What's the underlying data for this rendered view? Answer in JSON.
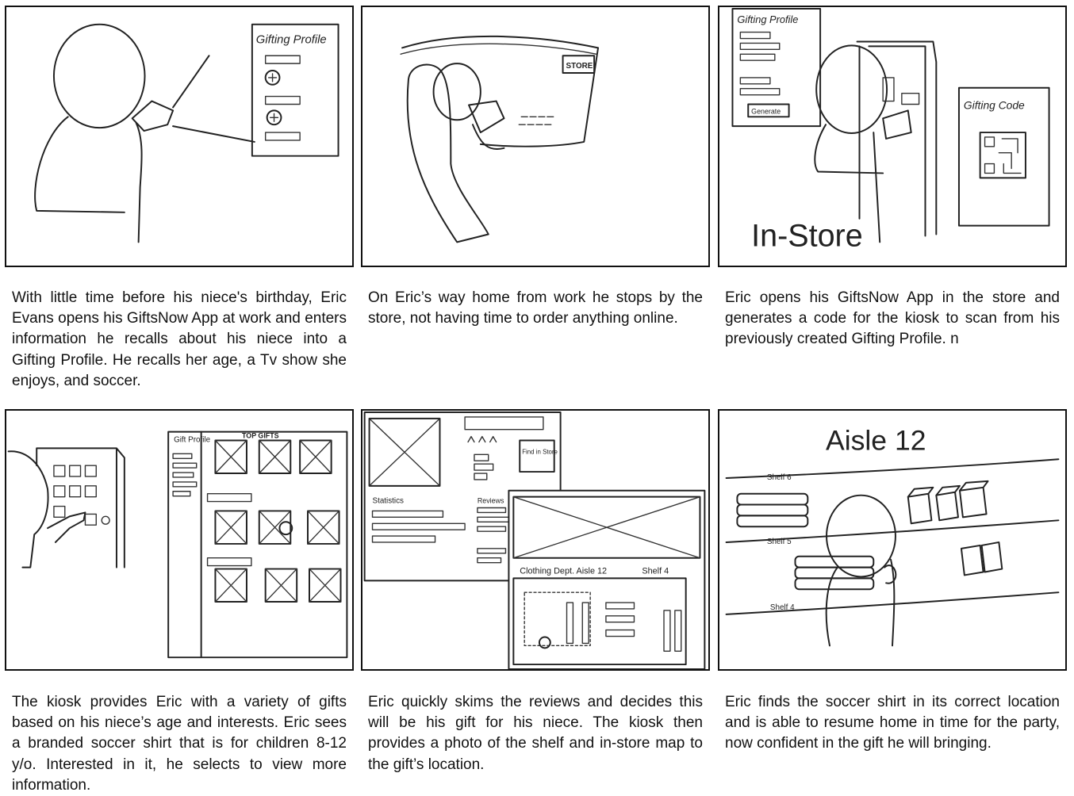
{
  "panels": [
    {
      "caption": "With little time before his niece's birthday, Eric Evans opens his GiftsNow App at work and enters information he recalls about his niece into a Gifting Profile. He recalls her age, a Tv show she enjoys, and soccer.",
      "labels": [
        "Gifting Profile"
      ]
    },
    {
      "caption": "On Eric’s way home from work he stops by the store, not having time to order anything online.",
      "labels": [
        "STORE"
      ]
    },
    {
      "caption": "Eric opens his GiftsNow App in the store and generates a code for the kiosk to scan from his previously created Gifting Profile. n",
      "labels": [
        "Gifting Profile",
        "Generate",
        "Gifting Code",
        "In-Store"
      ]
    },
    {
      "caption": "The kiosk provides Eric with a variety of gifts based on his niece’s age and interests. Eric sees a branded soccer shirt that is for children 8-12 y/o. Interested in it, he selects to view more information.",
      "labels": [
        "Gift Profile",
        "TOP GIFTS"
      ]
    },
    {
      "caption": "Eric quickly skims the reviews and decides this will be his gift for his niece. The kiosk then provides a photo of the shelf and in-store map to the gift’s location.",
      "labels": [
        "Statistics",
        "Reviews",
        "Find in Store",
        "Clothing Dept. Aisle 12",
        "Shelf 4"
      ]
    },
    {
      "caption": "Eric finds the soccer shirt in its correct location and is able to resume home in time for the party, now confident in the gift he will bringing.",
      "labels": [
        "Aisle 12",
        "Shelf 6",
        "Shelf 5",
        "Shelf 4"
      ]
    }
  ]
}
